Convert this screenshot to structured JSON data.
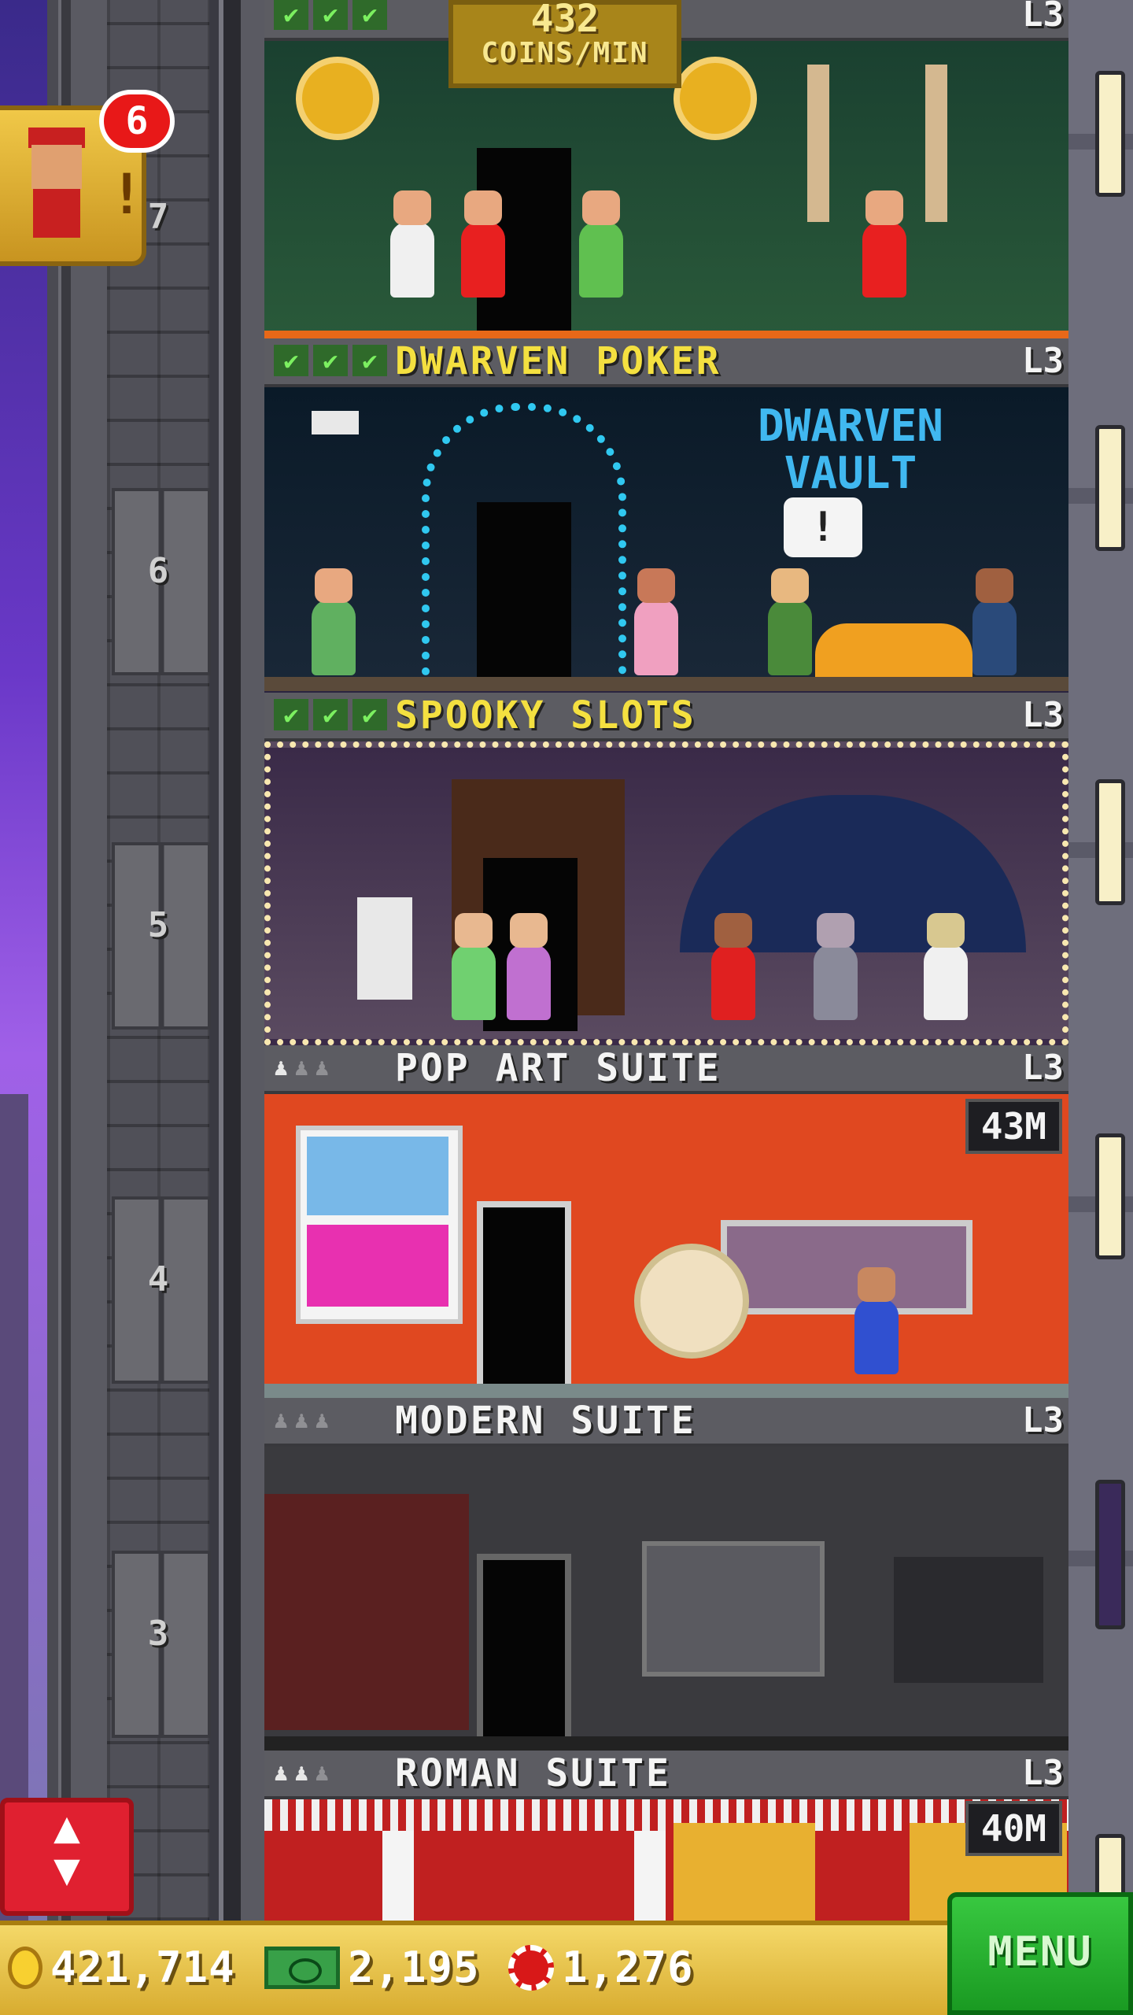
{
  "header": {
    "coins_rate_value": "432",
    "coins_rate_unit": "COINS/MIN"
  },
  "elevator_shaft": {
    "floor_numbers": [
      "7",
      "6",
      "5",
      "4",
      "3"
    ]
  },
  "bellhop": {
    "icon": "bellhop-icon",
    "notification_count": "6"
  },
  "floors": [
    {
      "name": "",
      "level": "L3",
      "stocked": 3,
      "residents": 0,
      "room_theme": "casino-lounge",
      "accent": "#f4e040"
    },
    {
      "name": "DWARVEN POKER",
      "level": "L3",
      "stocked": 3,
      "residents": 0,
      "room_theme": "dwarven-vault",
      "sign_text": "DWARVEN VAULT",
      "speech_bubble": "!",
      "accent": "#f4e040"
    },
    {
      "name": "SPOOKY SLOTS",
      "level": "L3",
      "stocked": 3,
      "residents": 0,
      "room_theme": "haunted-casino",
      "accent": "#f4e040"
    },
    {
      "name": "POP ART SUITE",
      "level": "L3",
      "residents": 1,
      "resident_slots": 3,
      "price": "43M",
      "room_theme": "pop-art",
      "accent": "#f4f4f4"
    },
    {
      "name": "MODERN SUITE",
      "level": "L3",
      "residents": 0,
      "resident_slots": 3,
      "room_theme": "modern",
      "accent": "#f4f4f4"
    },
    {
      "name": "ROMAN SUITE",
      "level": "L3",
      "residents": 2,
      "resident_slots": 3,
      "price": "40M",
      "room_theme": "roman",
      "accent": "#f4f4f4"
    }
  ],
  "bottom_bar": {
    "coins": "421,714",
    "tower_bux": "2,195",
    "chips": "1,276",
    "menu_label": "MENU"
  },
  "controls": {
    "elevator_icon": "up-down-arrows-icon"
  },
  "colors": {
    "stocked_check": "#7cf060",
    "floor_title_active": "#f4e040",
    "floor_title_residential": "#f4f4f4",
    "menu_button": "#22b02a",
    "elevator_button": "#e02030",
    "notification": "#e81818"
  }
}
